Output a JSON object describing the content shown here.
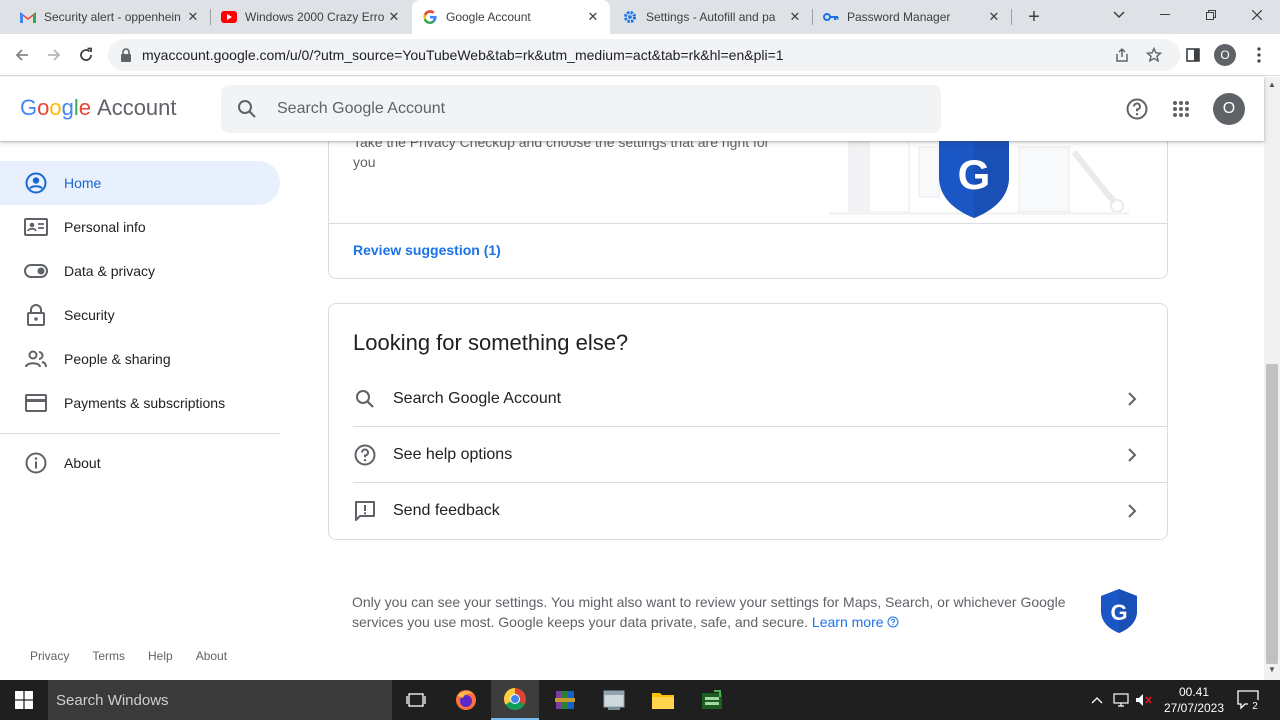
{
  "browser": {
    "tabs": [
      {
        "title": "Security alert - oppenhein",
        "favicon": "gmail-icon"
      },
      {
        "title": "Windows 2000 Crazy Erro",
        "favicon": "youtube-icon"
      },
      {
        "title": "Google Account",
        "favicon": "google-icon",
        "active": true
      },
      {
        "title": "Settings - Autofill and pa",
        "favicon": "settings-gear-icon"
      },
      {
        "title": "Password Manager",
        "favicon": "key-icon"
      }
    ],
    "url": "myaccount.google.com/u/0/?utm_source=YouTubeWeb&tab=rk&utm_medium=act&tab=rk&hl=en&pli=1",
    "profile_initial": "O"
  },
  "header": {
    "logo_google": "Google",
    "logo_account": "Account",
    "search_placeholder": "Search Google Account",
    "avatar_initial": "O"
  },
  "sidebar": {
    "items": [
      {
        "label": "Home",
        "icon": "account-circle-icon",
        "active": true
      },
      {
        "label": "Personal info",
        "icon": "id-card-icon"
      },
      {
        "label": "Data & privacy",
        "icon": "toggle-icon"
      },
      {
        "label": "Security",
        "icon": "lock-icon"
      },
      {
        "label": "People & sharing",
        "icon": "people-icon"
      },
      {
        "label": "Payments & subscriptions",
        "icon": "credit-card-icon"
      }
    ],
    "about": {
      "label": "About",
      "icon": "info-icon"
    },
    "footer": [
      "Privacy",
      "Terms",
      "Help",
      "About"
    ]
  },
  "privacy_card": {
    "description": "Take the Privacy Checkup and choose the settings that are right for you",
    "review_link": "Review suggestion (1)"
  },
  "help_card": {
    "title": "Looking for something else?",
    "rows": [
      {
        "label": "Search Google Account",
        "icon": "search-icon"
      },
      {
        "label": "See help options",
        "icon": "help-circle-icon"
      },
      {
        "label": "Send feedback",
        "icon": "feedback-icon"
      }
    ]
  },
  "privacy_note": {
    "text": "Only you can see your settings. You might also want to review your settings for Maps, Search, or whichever Google services you use most. Google keeps your data private, safe, and secure.",
    "learn_more": "Learn more"
  },
  "colors": {
    "accent_blue": "#1a73e8",
    "active_nav_bg": "#e8f0fe",
    "shield_blue": "#1a56c4"
  },
  "taskbar": {
    "search_placeholder": "Search Windows",
    "time": "00.41",
    "date": "27/07/2023",
    "notification_count": "2"
  }
}
